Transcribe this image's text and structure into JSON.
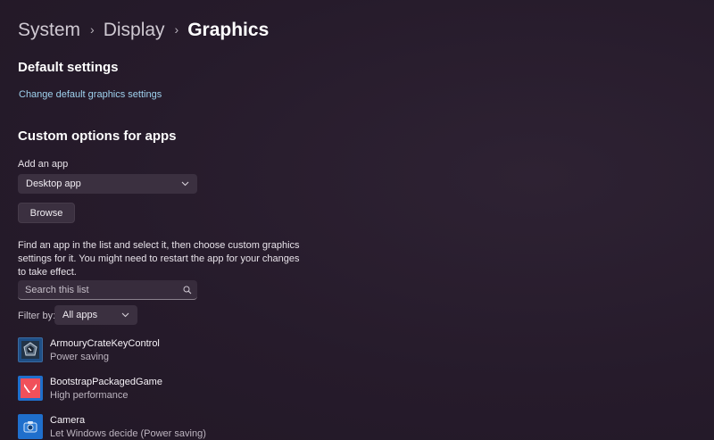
{
  "breadcrumb": {
    "items": [
      "System",
      "Display"
    ],
    "current": "Graphics"
  },
  "default_settings": {
    "title": "Default settings",
    "link": "Change default graphics settings"
  },
  "custom_options": {
    "title": "Custom options for apps",
    "add_app_label": "Add an app",
    "app_type_selected": "Desktop app",
    "browse_label": "Browse",
    "description": "Find an app in the list and select it, then choose custom graphics settings for it. You might need to restart the app for your changes to take effect.",
    "search_placeholder": "Search this list",
    "filter_label": "Filter by:",
    "filter_selected": "All apps"
  },
  "apps": [
    {
      "name": "ArmouryCrateKeyControl",
      "status": "Power saving",
      "icon": "armoury-crate-icon",
      "icon_color": "#1f4f86"
    },
    {
      "name": "BootstrapPackagedGame",
      "status": "High performance",
      "icon": "valorant-icon",
      "icon_color": "#f0505a"
    },
    {
      "name": "Camera",
      "status": "Let Windows decide (Power saving)",
      "icon": "camera-icon",
      "icon_color": "#1f6fcc"
    }
  ],
  "colors": {
    "background": "#271c2c",
    "link": "#9fd1ee",
    "control": "#3b3040"
  }
}
